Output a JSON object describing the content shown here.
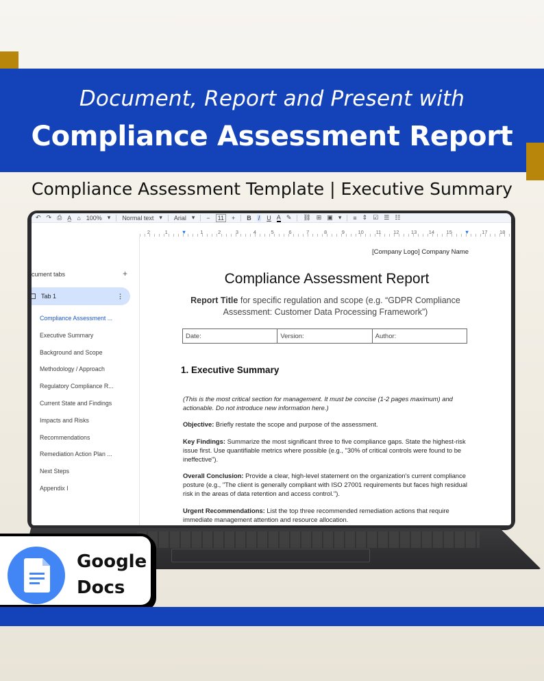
{
  "banner": {
    "subtitle": "Document, Report and Present with",
    "title": "Compliance Assessment Report"
  },
  "subtitle": "Compliance Assessment Template | Executive Summary",
  "toolbar": {
    "zoom": "100%",
    "style": "Normal text",
    "font": "Arial",
    "font_size": "11",
    "bold": "B",
    "italic": "I",
    "underline": "U",
    "text_color": "A"
  },
  "ruler": [
    "2",
    "1",
    "",
    "1",
    "2",
    "3",
    "4",
    "5",
    "6",
    "7",
    "8",
    "9",
    "10",
    "11",
    "12",
    "13",
    "14",
    "15",
    "16",
    "17",
    "18"
  ],
  "sidebar": {
    "header": "cument tabs",
    "add": "+",
    "tab": "Tab 1",
    "tab_menu": "⋮",
    "items": [
      "Compliance Assessment ...",
      "Executive Summary",
      "Background and Scope",
      "Methodology / Approach",
      "Regulatory Compliance R...",
      "Current State and Findings",
      "Impacts and Risks",
      "Recommendations",
      "Remediation Action Plan ...",
      "Next Steps",
      "Appendix I"
    ]
  },
  "document": {
    "company": "[Company Logo] Company Name",
    "title": "Compliance Assessment Report",
    "report_title_label": "Report Title",
    "report_title_rest": " for specific regulation and scope (e.g. “GDPR Compliance Assessment: Customer Data Processing Framework”)",
    "table": {
      "date": "Date:",
      "version": "Version:",
      "author": "Author:"
    },
    "section_heading": "1. Executive Summary",
    "intro": "(This is the most critical section for management. It must be concise (1-2 pages maximum) and actionable. Do not introduce new information here.)",
    "objective_label": "Objective:",
    "objective_text": " Briefly restate the scope and purpose of the assessment.",
    "findings_label": "Key Findings:",
    "findings_text": " Summarize the most significant three to five compliance gaps. State the highest-risk issue first. Use quantifiable metrics where possible (e.g., \"30% of critical controls were found to be ineffective\").",
    "conclusion_label": "Overall Conclusion:",
    "conclusion_text": " Provide a clear, high-level statement on the organization's current compliance posture (e.g., \"The client is generally compliant with ISO 27001 requirements but faces high residual risk in the areas of data retention and access control.\").",
    "urgent_label": "Urgent Recommendations:",
    "urgent_text": " List the top three recommended remediation actions that require immediate management attention and resource allocation."
  },
  "badge": {
    "line1": "Google",
    "line2": "Docs"
  },
  "colors": {
    "banner_blue": "#1442b8",
    "gold": "#b8860b",
    "docs_blue": "#4285f4",
    "active_tab": "#d3e3fd"
  }
}
